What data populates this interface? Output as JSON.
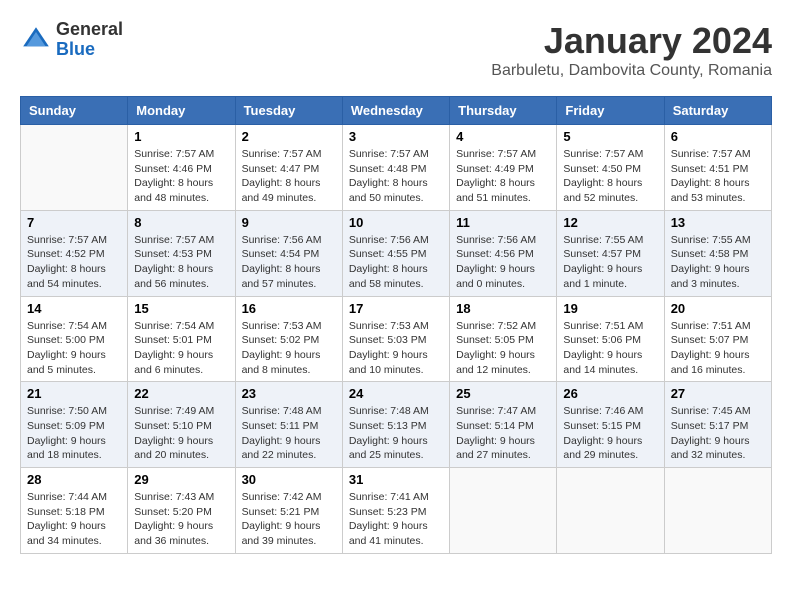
{
  "header": {
    "logo_general": "General",
    "logo_blue": "Blue",
    "month_title": "January 2024",
    "location": "Barbuletu, Dambovita County, Romania"
  },
  "weekdays": [
    "Sunday",
    "Monday",
    "Tuesday",
    "Wednesday",
    "Thursday",
    "Friday",
    "Saturday"
  ],
  "weeks": [
    [
      {
        "day": "",
        "empty": true
      },
      {
        "day": "1",
        "sunrise": "Sunrise: 7:57 AM",
        "sunset": "Sunset: 4:46 PM",
        "daylight": "Daylight: 8 hours and 48 minutes."
      },
      {
        "day": "2",
        "sunrise": "Sunrise: 7:57 AM",
        "sunset": "Sunset: 4:47 PM",
        "daylight": "Daylight: 8 hours and 49 minutes."
      },
      {
        "day": "3",
        "sunrise": "Sunrise: 7:57 AM",
        "sunset": "Sunset: 4:48 PM",
        "daylight": "Daylight: 8 hours and 50 minutes."
      },
      {
        "day": "4",
        "sunrise": "Sunrise: 7:57 AM",
        "sunset": "Sunset: 4:49 PM",
        "daylight": "Daylight: 8 hours and 51 minutes."
      },
      {
        "day": "5",
        "sunrise": "Sunrise: 7:57 AM",
        "sunset": "Sunset: 4:50 PM",
        "daylight": "Daylight: 8 hours and 52 minutes."
      },
      {
        "day": "6",
        "sunrise": "Sunrise: 7:57 AM",
        "sunset": "Sunset: 4:51 PM",
        "daylight": "Daylight: 8 hours and 53 minutes."
      }
    ],
    [
      {
        "day": "7",
        "sunrise": "Sunrise: 7:57 AM",
        "sunset": "Sunset: 4:52 PM",
        "daylight": "Daylight: 8 hours and 54 minutes."
      },
      {
        "day": "8",
        "sunrise": "Sunrise: 7:57 AM",
        "sunset": "Sunset: 4:53 PM",
        "daylight": "Daylight: 8 hours and 56 minutes."
      },
      {
        "day": "9",
        "sunrise": "Sunrise: 7:56 AM",
        "sunset": "Sunset: 4:54 PM",
        "daylight": "Daylight: 8 hours and 57 minutes."
      },
      {
        "day": "10",
        "sunrise": "Sunrise: 7:56 AM",
        "sunset": "Sunset: 4:55 PM",
        "daylight": "Daylight: 8 hours and 58 minutes."
      },
      {
        "day": "11",
        "sunrise": "Sunrise: 7:56 AM",
        "sunset": "Sunset: 4:56 PM",
        "daylight": "Daylight: 9 hours and 0 minutes."
      },
      {
        "day": "12",
        "sunrise": "Sunrise: 7:55 AM",
        "sunset": "Sunset: 4:57 PM",
        "daylight": "Daylight: 9 hours and 1 minute."
      },
      {
        "day": "13",
        "sunrise": "Sunrise: 7:55 AM",
        "sunset": "Sunset: 4:58 PM",
        "daylight": "Daylight: 9 hours and 3 minutes."
      }
    ],
    [
      {
        "day": "14",
        "sunrise": "Sunrise: 7:54 AM",
        "sunset": "Sunset: 5:00 PM",
        "daylight": "Daylight: 9 hours and 5 minutes."
      },
      {
        "day": "15",
        "sunrise": "Sunrise: 7:54 AM",
        "sunset": "Sunset: 5:01 PM",
        "daylight": "Daylight: 9 hours and 6 minutes."
      },
      {
        "day": "16",
        "sunrise": "Sunrise: 7:53 AM",
        "sunset": "Sunset: 5:02 PM",
        "daylight": "Daylight: 9 hours and 8 minutes."
      },
      {
        "day": "17",
        "sunrise": "Sunrise: 7:53 AM",
        "sunset": "Sunset: 5:03 PM",
        "daylight": "Daylight: 9 hours and 10 minutes."
      },
      {
        "day": "18",
        "sunrise": "Sunrise: 7:52 AM",
        "sunset": "Sunset: 5:05 PM",
        "daylight": "Daylight: 9 hours and 12 minutes."
      },
      {
        "day": "19",
        "sunrise": "Sunrise: 7:51 AM",
        "sunset": "Sunset: 5:06 PM",
        "daylight": "Daylight: 9 hours and 14 minutes."
      },
      {
        "day": "20",
        "sunrise": "Sunrise: 7:51 AM",
        "sunset": "Sunset: 5:07 PM",
        "daylight": "Daylight: 9 hours and 16 minutes."
      }
    ],
    [
      {
        "day": "21",
        "sunrise": "Sunrise: 7:50 AM",
        "sunset": "Sunset: 5:09 PM",
        "daylight": "Daylight: 9 hours and 18 minutes."
      },
      {
        "day": "22",
        "sunrise": "Sunrise: 7:49 AM",
        "sunset": "Sunset: 5:10 PM",
        "daylight": "Daylight: 9 hours and 20 minutes."
      },
      {
        "day": "23",
        "sunrise": "Sunrise: 7:48 AM",
        "sunset": "Sunset: 5:11 PM",
        "daylight": "Daylight: 9 hours and 22 minutes."
      },
      {
        "day": "24",
        "sunrise": "Sunrise: 7:48 AM",
        "sunset": "Sunset: 5:13 PM",
        "daylight": "Daylight: 9 hours and 25 minutes."
      },
      {
        "day": "25",
        "sunrise": "Sunrise: 7:47 AM",
        "sunset": "Sunset: 5:14 PM",
        "daylight": "Daylight: 9 hours and 27 minutes."
      },
      {
        "day": "26",
        "sunrise": "Sunrise: 7:46 AM",
        "sunset": "Sunset: 5:15 PM",
        "daylight": "Daylight: 9 hours and 29 minutes."
      },
      {
        "day": "27",
        "sunrise": "Sunrise: 7:45 AM",
        "sunset": "Sunset: 5:17 PM",
        "daylight": "Daylight: 9 hours and 32 minutes."
      }
    ],
    [
      {
        "day": "28",
        "sunrise": "Sunrise: 7:44 AM",
        "sunset": "Sunset: 5:18 PM",
        "daylight": "Daylight: 9 hours and 34 minutes."
      },
      {
        "day": "29",
        "sunrise": "Sunrise: 7:43 AM",
        "sunset": "Sunset: 5:20 PM",
        "daylight": "Daylight: 9 hours and 36 minutes."
      },
      {
        "day": "30",
        "sunrise": "Sunrise: 7:42 AM",
        "sunset": "Sunset: 5:21 PM",
        "daylight": "Daylight: 9 hours and 39 minutes."
      },
      {
        "day": "31",
        "sunrise": "Sunrise: 7:41 AM",
        "sunset": "Sunset: 5:23 PM",
        "daylight": "Daylight: 9 hours and 41 minutes."
      },
      {
        "day": "",
        "empty": true
      },
      {
        "day": "",
        "empty": true
      },
      {
        "day": "",
        "empty": true
      }
    ]
  ]
}
